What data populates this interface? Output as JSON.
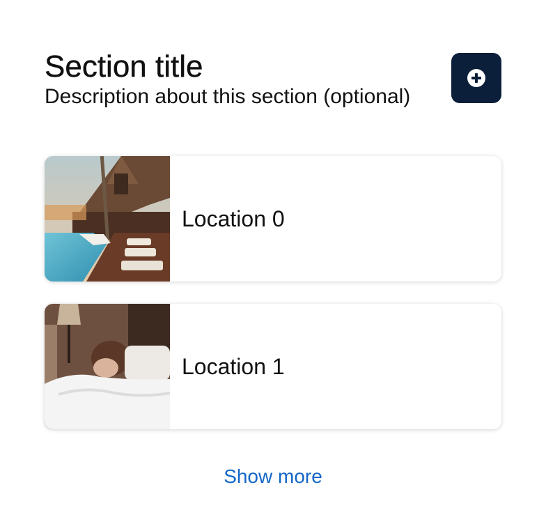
{
  "section": {
    "title": "Section title",
    "description": "Description about this section (optional)"
  },
  "add_button": {
    "icon": "plus-circle-icon",
    "background_color": "#0b1f3a"
  },
  "locations": [
    {
      "label": "Location 0",
      "image": "resort-pool-photo"
    },
    {
      "label": "Location 1",
      "image": "person-in-bed-photo"
    }
  ],
  "show_more_label": "Show more",
  "colors": {
    "link": "#1466c8",
    "text": "#111111"
  }
}
